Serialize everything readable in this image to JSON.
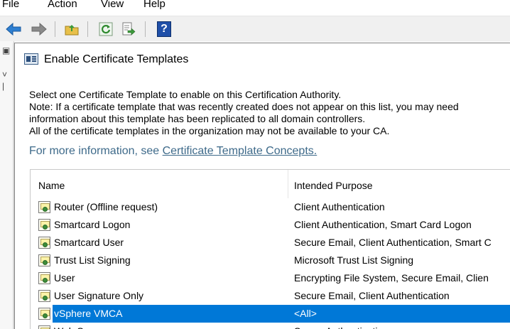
{
  "menubar": {
    "items": [
      "File",
      "Action",
      "View",
      "Help"
    ]
  },
  "toolbar": {
    "buttons": [
      "back-arrow-icon",
      "forward-arrow-icon",
      "up-folder-icon",
      "refresh-icon",
      "export-list-icon",
      "help-icon"
    ],
    "help_glyph": "?"
  },
  "dialog": {
    "title": "Enable Certificate Templates",
    "description": [
      "Select one Certificate Template to enable on this Certification Authority.",
      "Note: If a certificate template that was recently created does not appear on this list, you may need",
      "information about this template has been replicated to all domain controllers.",
      "All of the certificate templates in the organization may not be available to your CA."
    ],
    "more_info_prefix": "For more information, see ",
    "more_info_link": "Certificate Template Concepts.",
    "colors": {
      "link": "#3e6a8a",
      "selection": "#0078d7"
    }
  },
  "list": {
    "columns": [
      "Name",
      "Intended Purpose"
    ],
    "rows": [
      {
        "name": "Router (Offline request)",
        "purpose": "Client Authentication"
      },
      {
        "name": "Smartcard Logon",
        "purpose": "Client Authentication, Smart Card Logon"
      },
      {
        "name": "Smartcard User",
        "purpose": "Secure Email, Client Authentication, Smart C"
      },
      {
        "name": "Trust List Signing",
        "purpose": "Microsoft Trust List Signing"
      },
      {
        "name": "User",
        "purpose": "Encrypting File System, Secure Email, Clien"
      },
      {
        "name": "User Signature Only",
        "purpose": "Secure Email, Client Authentication"
      },
      {
        "name": "vSphere VMCA",
        "purpose": "<All>"
      },
      {
        "name": "Web Server",
        "purpose": "Server Authentication"
      }
    ],
    "selected_index": 6
  }
}
